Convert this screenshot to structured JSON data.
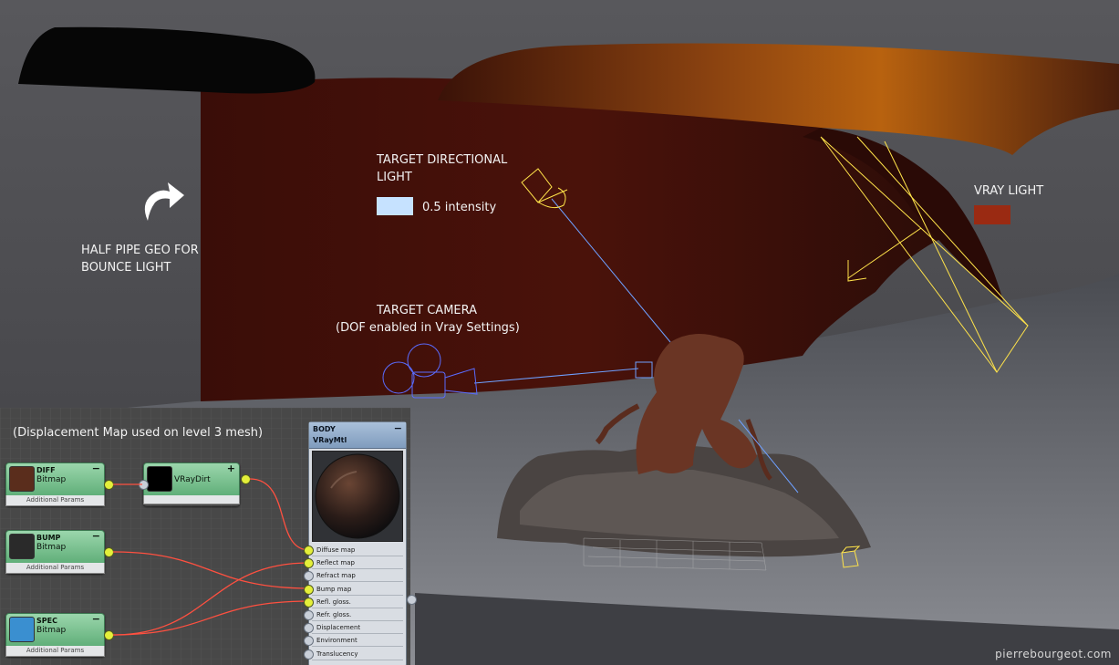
{
  "viewport": {
    "labels": {
      "half_pipe": [
        "HALF PIPE GEO FOR",
        "BOUNCE LIGHT"
      ],
      "directional_light": [
        "TARGET DIRECTIONAL",
        "LIGHT"
      ],
      "intensity": "0.5 intensity",
      "camera": "TARGET CAMERA",
      "camera_note": "(DOF enabled in Vray Settings)",
      "vray_light": "VRAY LIGHT",
      "displacement_note": "(Displacement Map used on level 3 mesh)"
    },
    "colors": {
      "directional_light_swatch": "#c6e2ff",
      "vray_light_swatch": "#9a2a12",
      "light_gizmo": "#ffe34a",
      "camera_gizmo": "#5a6cff"
    },
    "icons": [
      "curved-arrow-icon"
    ]
  },
  "node_editor": {
    "nodes": [
      {
        "title": "DIFF",
        "type": "Bitmap",
        "footer": "Additional Params",
        "thumb_color": "#5a2d1c",
        "collapse": "−"
      },
      {
        "title": "BUMP",
        "type": "Bitmap",
        "footer": "Additional Params",
        "thumb_color": "#2a2a2a",
        "collapse": "−"
      },
      {
        "title": "SPEC",
        "type": "Bitmap",
        "footer": "Additional Params",
        "thumb_color": "#3a8fd0",
        "collapse": "−"
      },
      {
        "title": "",
        "type": "VRayDirt",
        "footer": "",
        "thumb_color": "#000000",
        "collapse": "+"
      }
    ],
    "material": {
      "title": "BODY",
      "type": "VRayMtl",
      "collapse": "−",
      "slots": [
        {
          "label": "Diffuse map",
          "connected": true
        },
        {
          "label": "Reflect map",
          "connected": true
        },
        {
          "label": "Refract map",
          "connected": false
        },
        {
          "label": "Bump map",
          "connected": true
        },
        {
          "label": "Refl. gloss.",
          "connected": true
        },
        {
          "label": "Refr. gloss.",
          "connected": false
        },
        {
          "label": "Displacement",
          "connected": false
        },
        {
          "label": "Environment",
          "connected": false
        },
        {
          "label": "Translucency",
          "connected": false
        }
      ]
    },
    "wire_color": "#ff5040"
  },
  "watermark": "pierrebourgeot.com"
}
